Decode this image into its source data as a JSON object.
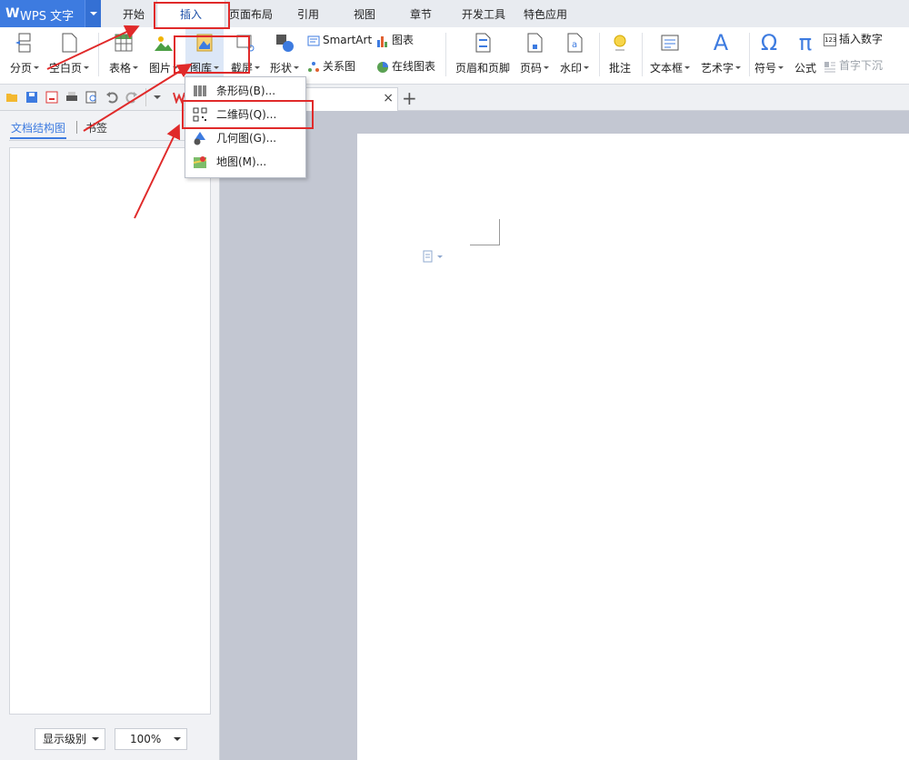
{
  "app": {
    "name": "WPS 文字",
    "logo": "W"
  },
  "tabs": [
    "开始",
    "插入",
    "页面布局",
    "引用",
    "视图",
    "章节",
    "开发工具",
    "特色应用"
  ],
  "ribbon": {
    "page_break": "分页",
    "blank_page": "空白页",
    "table": "表格",
    "picture": "图片",
    "gallery": "图库",
    "screenshot": "截屏",
    "shape": "形状",
    "smartart": "SmartArt",
    "chart": "图表",
    "relation": "关系图",
    "online_chart": "在线图表",
    "header_footer": "页眉和页脚",
    "page_number": "页码",
    "watermark": "水印",
    "comment": "批注",
    "textbox": "文本框",
    "wordart": "艺术字",
    "symbol": "符号",
    "formula": "公式",
    "insert_number": "插入数字",
    "dropcap": "首字下沉",
    "symbol_glyph": "Ω",
    "formula_glyph": "π",
    "wordart_glyph": "A",
    "number_badge": "123"
  },
  "gallery_menu": [
    "条形码(B)...",
    "二维码(Q)...",
    "几何图(G)...",
    "地图(M)..."
  ],
  "doc_tab": {
    "close": "×",
    "add": "+"
  },
  "left_panel": {
    "tabs": [
      "文档结构图",
      "书签"
    ],
    "level_select": "显示级别",
    "zoom_select": "100%"
  },
  "colors": {
    "accent": "#3d7be0",
    "highlight": "#e02a2a"
  }
}
